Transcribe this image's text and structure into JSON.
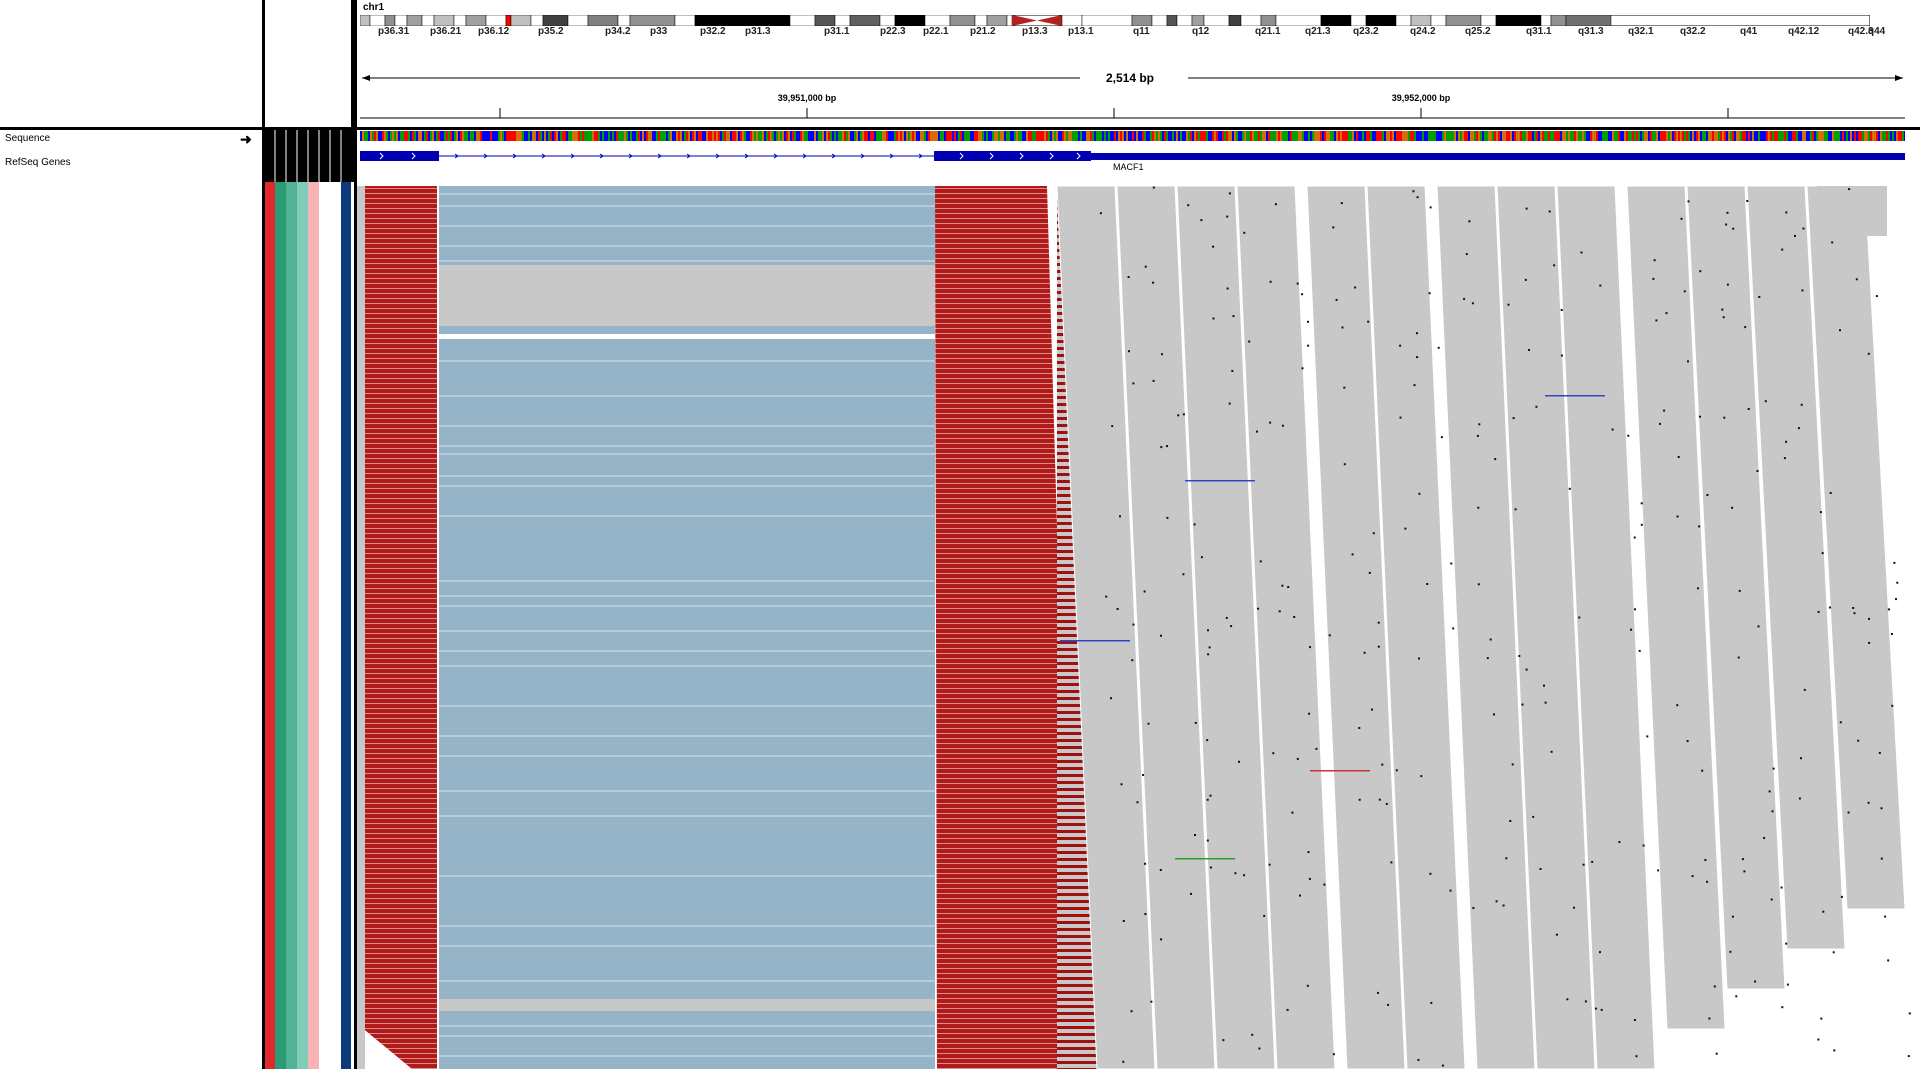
{
  "header": {
    "chromosome": "chr1",
    "span_label": "2,514 bp",
    "ruler_ticks": [
      {
        "label": "39,951,000 bp"
      },
      {
        "label": "39,952,000 bp"
      }
    ]
  },
  "ideogram": {
    "bands": [
      "p36.31",
      "p36.21",
      "p36.12",
      "p35.2",
      "p34.2",
      "p33",
      "p32.2",
      "p31.3",
      "p31.1",
      "p22.3",
      "p22.1",
      "p21.2",
      "p13.3",
      "p13.1",
      "q11",
      "q12",
      "q21.1",
      "q21.3",
      "q23.2",
      "q24.2",
      "q25.2",
      "q31.1",
      "q31.3",
      "q32.1",
      "q32.2",
      "q41",
      "q42.12",
      "q42.3",
      "q44"
    ],
    "highlight_color": "#ff0000"
  },
  "tracks": {
    "sequence_label": "Sequence",
    "genes_label": "RefSeq Genes",
    "gene_name": "MACF1"
  },
  "colors": {
    "gene": "#0000b2",
    "read": "#c8c8c8",
    "insert_large": "#96b4c8",
    "insert_small": "#990000",
    "attr_red": "#e0282d",
    "attr_teal": "#2a9d76",
    "attr_mint": "#7fcdb8",
    "attr_pink": "#f8b4b4",
    "attr_navy": "#0d3a7a"
  }
}
